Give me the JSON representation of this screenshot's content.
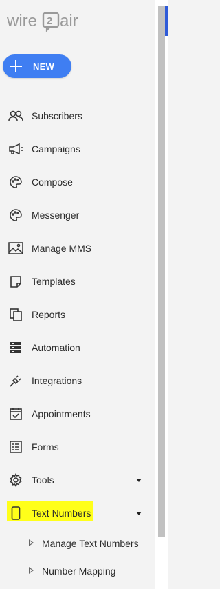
{
  "brand": {
    "logo_text": "wire2air",
    "accent": "#3f7ef2",
    "highlight": "#ffff1a"
  },
  "new_button": {
    "label": "NEW",
    "icon": "plus-icon"
  },
  "nav": {
    "items": [
      {
        "label": "Subscribers",
        "icon": "subscribers-icon"
      },
      {
        "label": "Campaigns",
        "icon": "megaphone-icon"
      },
      {
        "label": "Compose",
        "icon": "palette-icon"
      },
      {
        "label": "Messenger",
        "icon": "palette-chat-icon"
      },
      {
        "label": "Manage MMS",
        "icon": "image-icon"
      },
      {
        "label": "Templates",
        "icon": "template-icon"
      },
      {
        "label": "Reports",
        "icon": "reports-icon"
      },
      {
        "label": "Automation",
        "icon": "automation-icon"
      },
      {
        "label": "Integrations",
        "icon": "plug-icon"
      },
      {
        "label": "Appointments",
        "icon": "calendar-check-icon"
      },
      {
        "label": "Forms",
        "icon": "form-list-icon"
      },
      {
        "label": "Tools",
        "icon": "gear-icon",
        "expandable": true
      },
      {
        "label": "Text Numbers",
        "icon": "phone-icon",
        "expandable": true,
        "highlighted": true
      }
    ],
    "sub_items": [
      {
        "label": "Manage Text Numbers"
      },
      {
        "label": "Number Mapping"
      }
    ]
  }
}
